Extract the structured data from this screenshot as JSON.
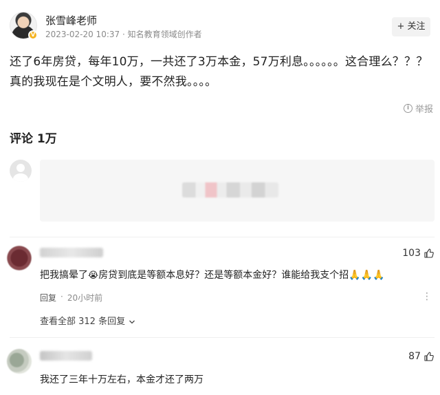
{
  "author": {
    "name": "张雪峰老师",
    "meta": "2023-02-20 10:37 · 知名教育领域创作者",
    "follow_label": "+ 关注",
    "verified_badge": "V"
  },
  "post": {
    "line1": "还了6年房贷，每年10万，一共还了3万本金，57万利息。。。。。。这合理么？？？",
    "line2": "真的我现在是个文明人，要不然我。。。。"
  },
  "report_label": "举报",
  "comments_header": "评论 1万",
  "comments": [
    {
      "likes": "103",
      "text_before": "把我搞晕了",
      "emoji": "😭",
      "text_after": "房贷到底是等额本息好？还是等额本金好？谁能给我支个招🙏🙏🙏",
      "reply_label": "回复",
      "time": "20小时前",
      "view_replies": "查看全部 312 条回复"
    },
    {
      "likes": "87",
      "text": "我还了三年十万左右，本金才还了两万"
    }
  ],
  "icons": {
    "thumb": "thumbs-up-icon",
    "info": "info-icon",
    "more": "more-icon",
    "chevron": "chevron-down-icon"
  }
}
